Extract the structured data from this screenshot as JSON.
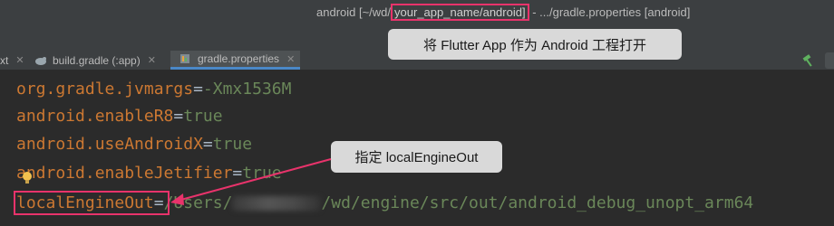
{
  "window": {
    "title_prefix": "android [~/wd/",
    "title_highlight": "your_app_name/android]",
    "title_suffix": " - .../gradle.properties [android]"
  },
  "tabs": [
    {
      "label": "xt",
      "active": false
    },
    {
      "label": "build.gradle (:app)",
      "active": false
    },
    {
      "label": "gradle.properties",
      "active": true
    }
  ],
  "editor": {
    "lines": [
      {
        "key": "org.gradle.jvmargs",
        "eq": "=",
        "value": "-Xmx1536M"
      },
      {
        "key": "android.enableR8",
        "eq": "=",
        "value": "true"
      },
      {
        "key": "android.useAndroidX",
        "eq": "=",
        "value": "true"
      },
      {
        "key": "android.enableJetifier",
        "eq": "=",
        "value": "true"
      }
    ],
    "last_line": {
      "key": "localEngineOut",
      "eq": "=",
      "value_prefix": "/Users/",
      "value_suffix": "/wd/engine/src/out/android_debug_unopt_arm64"
    }
  },
  "callouts": {
    "open_as_android": "将 Flutter App 作为 Android 工程打开",
    "specify_engine": "指定 localEngineOut"
  },
  "colors": {
    "highlight": "#e8336b",
    "key": "#cc7832",
    "value": "#6a8759",
    "tab_underline": "#4a88c7"
  },
  "icons": [
    "gradle-icon",
    "properties-icon",
    "hammer-icon",
    "lightbulb-icon",
    "close-icon"
  ]
}
